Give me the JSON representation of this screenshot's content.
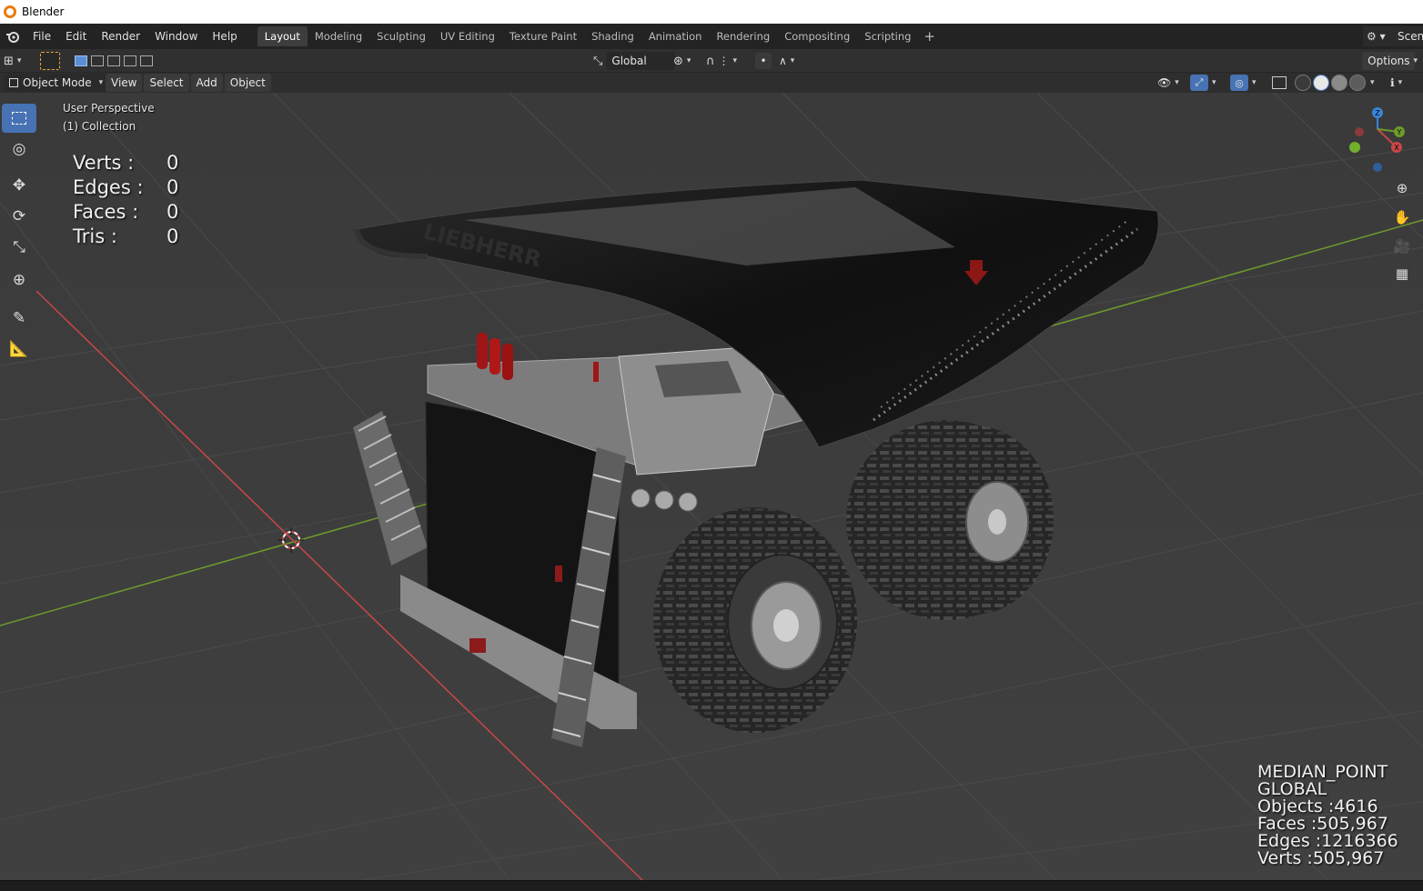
{
  "window": {
    "title": "Blender"
  },
  "menu": [
    "File",
    "Edit",
    "Render",
    "Window",
    "Help"
  ],
  "workspaces": [
    "Layout",
    "Modeling",
    "Sculpting",
    "UV Editing",
    "Texture Paint",
    "Shading",
    "Animation",
    "Rendering",
    "Compositing",
    "Scripting"
  ],
  "active_workspace": "Layout",
  "scene_name": "Scene",
  "tool_header": {
    "orientation": "Global",
    "options_label": "Options"
  },
  "view_header": {
    "mode": "Object Mode",
    "menus": [
      "View",
      "Select",
      "Add",
      "Object"
    ]
  },
  "viewport": {
    "perspective_label": "User Perspective",
    "collection_label": "(1) Collection",
    "stats": [
      {
        "label": "Verts :",
        "value": "0"
      },
      {
        "label": "Edges :",
        "value": "0"
      },
      {
        "label": "Faces :",
        "value": "0"
      },
      {
        "label": "Tris :",
        "value": "0"
      }
    ],
    "corner_stats": [
      "MEDIAN_POINT",
      "GLOBAL",
      "Objects :4616",
      "Faces :505,967",
      "Edges :1216366",
      "Verts :505,967"
    ],
    "model_text": "LIEBHERR",
    "gizmo_axes": [
      "Z",
      "Y",
      "X"
    ]
  },
  "tools": [
    "select-box",
    "cursor",
    "move",
    "rotate",
    "scale",
    "transform",
    "annotate",
    "measure"
  ],
  "colors": {
    "accent": "#4772b3",
    "x_axis": "#c84747",
    "y_axis": "#6e9a2b",
    "z_axis": "#3b84d8"
  }
}
